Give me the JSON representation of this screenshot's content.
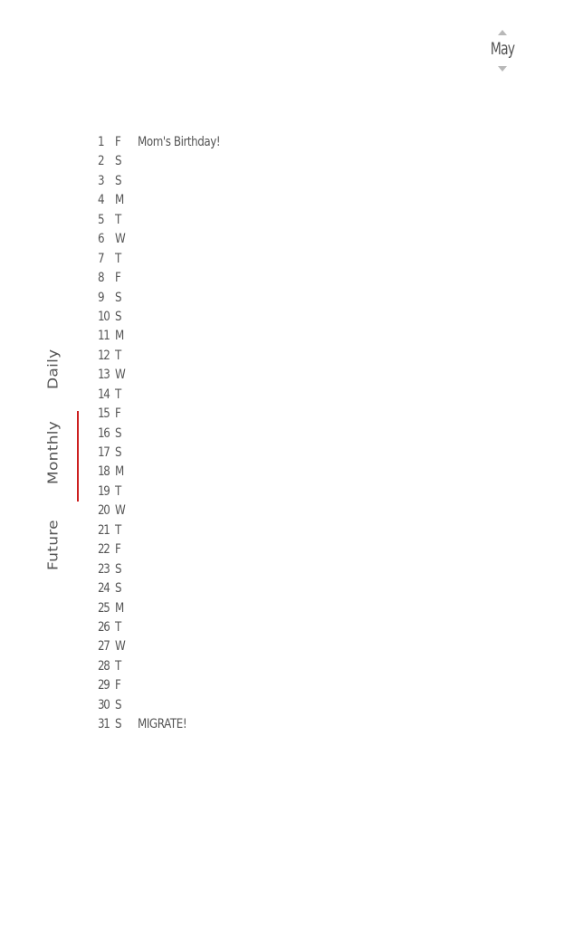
{
  "month_picker": {
    "month": "May",
    "up_icon": "chevron-up-icon",
    "down_icon": "chevron-down-icon"
  },
  "nav": {
    "tabs": [
      {
        "label": "Daily",
        "active": false
      },
      {
        "label": "Monthly",
        "active": true
      },
      {
        "label": "Future",
        "active": false
      }
    ],
    "active_color": "#cc1f1f"
  },
  "days": [
    {
      "num": "1",
      "letter": "F",
      "event": "Mom's Birthday!"
    },
    {
      "num": "2",
      "letter": "S",
      "event": ""
    },
    {
      "num": "3",
      "letter": "S",
      "event": ""
    },
    {
      "num": "4",
      "letter": "M",
      "event": ""
    },
    {
      "num": "5",
      "letter": "T",
      "event": ""
    },
    {
      "num": "6",
      "letter": "W",
      "event": ""
    },
    {
      "num": "7",
      "letter": "T",
      "event": ""
    },
    {
      "num": "8",
      "letter": "F",
      "event": ""
    },
    {
      "num": "9",
      "letter": "S",
      "event": ""
    },
    {
      "num": "10",
      "letter": "S",
      "event": ""
    },
    {
      "num": "11",
      "letter": "M",
      "event": ""
    },
    {
      "num": "12",
      "letter": "T",
      "event": ""
    },
    {
      "num": "13",
      "letter": "W",
      "event": ""
    },
    {
      "num": "14",
      "letter": "T",
      "event": ""
    },
    {
      "num": "15",
      "letter": "F",
      "event": ""
    },
    {
      "num": "16",
      "letter": "S",
      "event": ""
    },
    {
      "num": "17",
      "letter": "S",
      "event": ""
    },
    {
      "num": "18",
      "letter": "M",
      "event": ""
    },
    {
      "num": "19",
      "letter": "T",
      "event": ""
    },
    {
      "num": "20",
      "letter": "W",
      "event": ""
    },
    {
      "num": "21",
      "letter": "T",
      "event": ""
    },
    {
      "num": "22",
      "letter": "F",
      "event": ""
    },
    {
      "num": "23",
      "letter": "S",
      "event": ""
    },
    {
      "num": "24",
      "letter": "S",
      "event": ""
    },
    {
      "num": "25",
      "letter": "M",
      "event": ""
    },
    {
      "num": "26",
      "letter": "T",
      "event": ""
    },
    {
      "num": "27",
      "letter": "W",
      "event": ""
    },
    {
      "num": "28",
      "letter": "T",
      "event": ""
    },
    {
      "num": "29",
      "letter": "F",
      "event": ""
    },
    {
      "num": "30",
      "letter": "S",
      "event": ""
    },
    {
      "num": "31",
      "letter": "S",
      "event": "MIGRATE!"
    }
  ]
}
